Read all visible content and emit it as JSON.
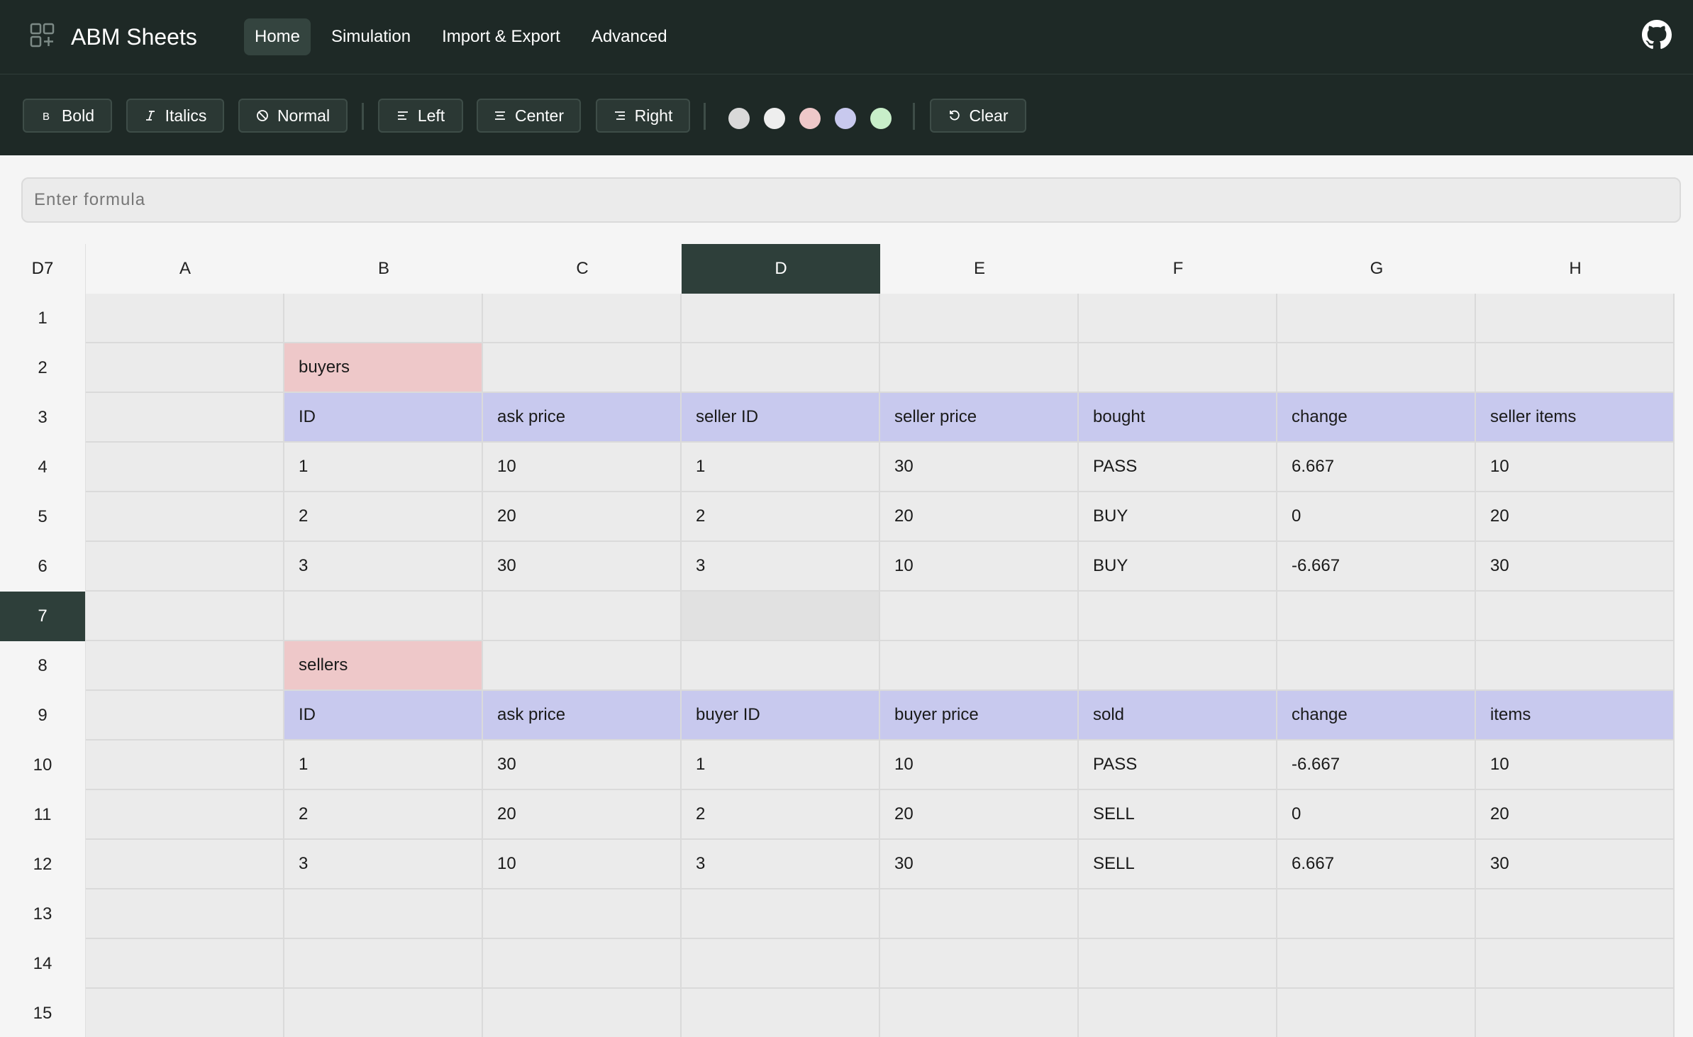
{
  "app": {
    "title": "ABM Sheets"
  },
  "nav": {
    "tabs": [
      {
        "label": "Home",
        "active": true
      },
      {
        "label": "Simulation"
      },
      {
        "label": "Import & Export"
      },
      {
        "label": "Advanced"
      }
    ]
  },
  "toolbar": {
    "bold": "Bold",
    "italics": "Italics",
    "normal": "Normal",
    "left": "Left",
    "center": "Center",
    "right": "Right",
    "clear": "Clear",
    "swatches": [
      "#d9d9d9",
      "#eeeeee",
      "#eec8c9",
      "#c8c9ee",
      "#c8eec9"
    ]
  },
  "formula": {
    "placeholder": "Enter formula",
    "value": ""
  },
  "sheet": {
    "selected_cell": "D7",
    "selected_col": "D",
    "selected_row": "7",
    "columns": [
      "A",
      "B",
      "C",
      "D",
      "E",
      "F",
      "G",
      "H"
    ],
    "rows": [
      "1",
      "2",
      "3",
      "4",
      "5",
      "6",
      "7",
      "8",
      "9",
      "10",
      "11",
      "12",
      "13",
      "14",
      "15"
    ],
    "cells": {
      "2": [
        "",
        "buyers",
        "",
        "",
        "",
        "",
        "",
        ""
      ],
      "3": [
        "",
        "ID",
        "ask price",
        "seller ID",
        "seller price",
        "bought",
        "change",
        "seller items"
      ],
      "4": [
        "",
        "1",
        "10",
        "1",
        "30",
        "PASS",
        "6.667",
        "10"
      ],
      "5": [
        "",
        "2",
        "20",
        "2",
        "20",
        "BUY",
        "0",
        "20"
      ],
      "6": [
        "",
        "3",
        "30",
        "3",
        "10",
        "BUY",
        "-6.667",
        "30"
      ],
      "8": [
        "",
        "sellers",
        "",
        "",
        "",
        "",
        "",
        ""
      ],
      "9": [
        "",
        "ID",
        "ask price",
        "buyer ID",
        "buyer price",
        "sold",
        "change",
        "items"
      ],
      "10": [
        "",
        "1",
        "30",
        "1",
        "10",
        "PASS",
        "-6.667",
        "10"
      ],
      "11": [
        "",
        "2",
        "20",
        "2",
        "20",
        "SELL",
        "0",
        "20"
      ],
      "12": [
        "",
        "3",
        "10",
        "3",
        "30",
        "SELL",
        "6.667",
        "30"
      ]
    },
    "highlights": {
      "pink": [
        "B2",
        "B8"
      ],
      "lavender_rows": [
        "3",
        "9"
      ]
    }
  }
}
